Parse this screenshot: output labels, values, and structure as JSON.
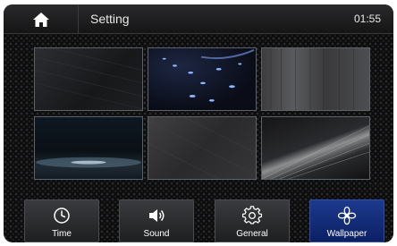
{
  "header": {
    "title": "Setting",
    "clock": "01:55"
  },
  "wallpapers": [
    {
      "icon": "wallpaper-1"
    },
    {
      "icon": "wallpaper-2"
    },
    {
      "icon": "wallpaper-3"
    },
    {
      "icon": "wallpaper-4"
    },
    {
      "icon": "wallpaper-5"
    },
    {
      "icon": "wallpaper-6"
    }
  ],
  "tabs": [
    {
      "label": "Time",
      "icon": "clock-icon"
    },
    {
      "label": "Sound",
      "icon": "speaker-icon"
    },
    {
      "label": "General",
      "icon": "gear-icon"
    },
    {
      "label": "Wallpaper",
      "icon": "flower-icon",
      "active": true
    }
  ],
  "colors": {
    "active_tab": "#1d3a8e",
    "background": "#0c0c0d"
  }
}
